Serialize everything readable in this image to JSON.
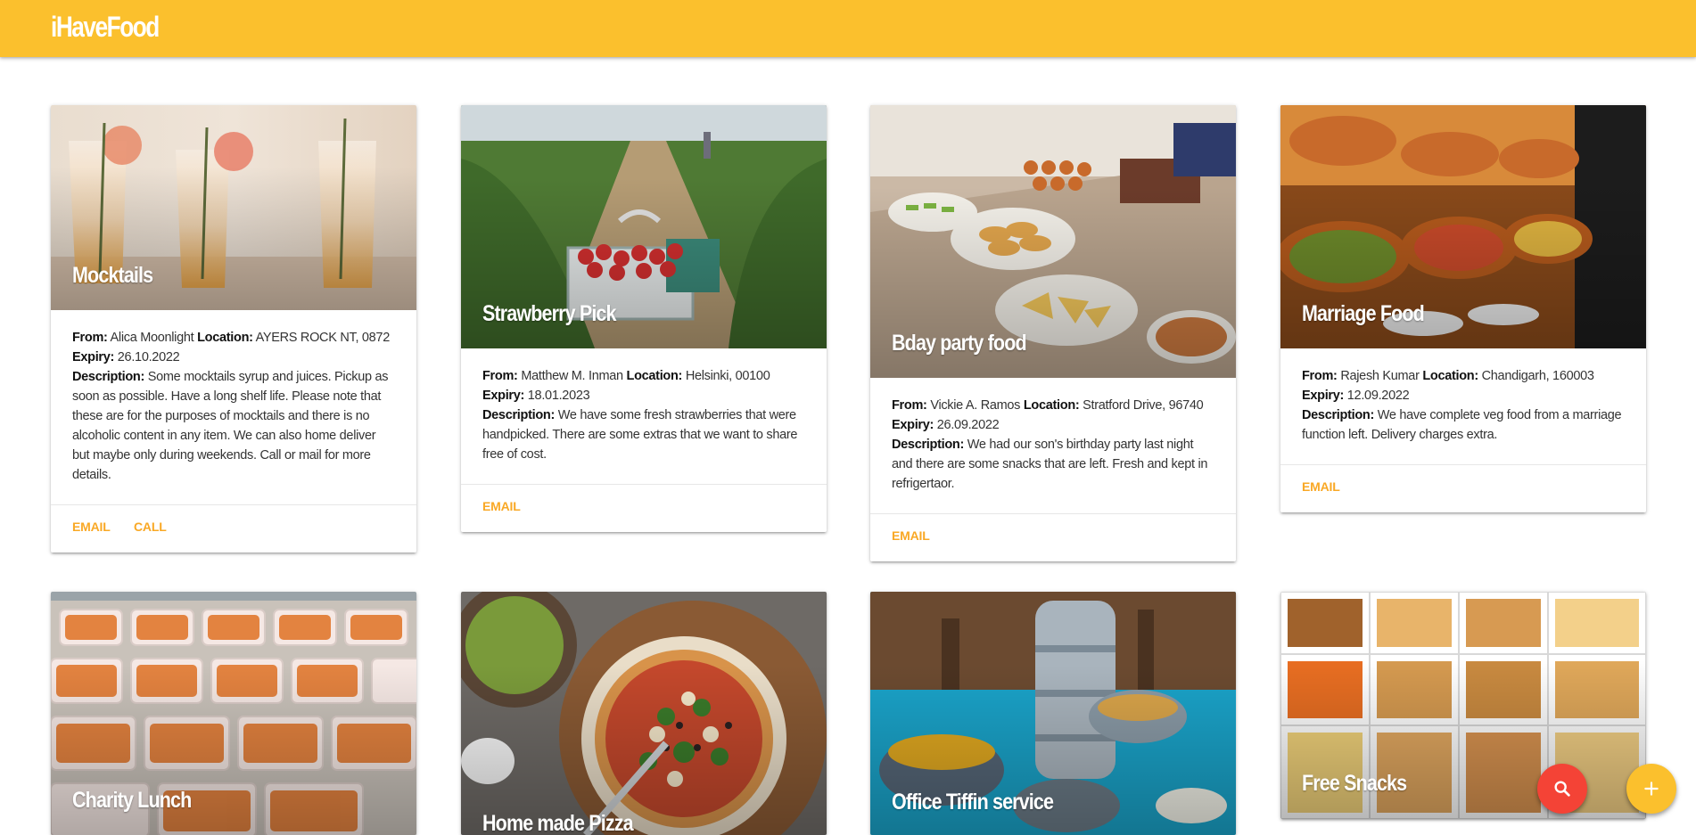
{
  "app": {
    "title": "iHaveFood"
  },
  "colors": {
    "header": "#fbc02d",
    "accent": "#f9a825",
    "search_fab": "#f44336",
    "add_fab": "#fbc02d"
  },
  "cards": [
    {
      "title": "Mocktails",
      "from_label": "From:",
      "from": "Alica Moonlight",
      "location_label": "Location:",
      "location": "AYERS ROCK NT, 0872",
      "expiry_label": "Expiry:",
      "expiry": "26.10.2022",
      "description_label": "Description:",
      "description": "Some mocktails syrup and juices. Pickup as soon as possible. Have a long shelf life. Please note that these are for the purposes of mocktails and there is no alcoholic content in any item. We can also home deliver but maybe only during weekends. Call or mail for more details.",
      "actions": [
        "EMAIL",
        "CALL"
      ]
    },
    {
      "title": "Strawberry Pick",
      "from_label": "From:",
      "from": "Matthew M. Inman",
      "location_label": "Location:",
      "location": "Helsinki, 00100",
      "expiry_label": "Expiry:",
      "expiry": "18.01.2023",
      "description_label": "Description:",
      "description": "We have some fresh strawberries that were handpicked. There are some extras that we want to share free of cost.",
      "actions": [
        "EMAIL"
      ]
    },
    {
      "title": "Bday party food",
      "from_label": "From:",
      "from": "Vickie A. Ramos",
      "location_label": "Location:",
      "location": "Stratford Drive, 96740",
      "expiry_label": "Expiry:",
      "expiry": "26.09.2022",
      "description_label": "Description:",
      "description": "We had our son's birthday party last night and there are some snacks that are left. Fresh and kept in refrigertaor.",
      "actions": [
        "EMAIL"
      ]
    },
    {
      "title": "Marriage Food",
      "from_label": "From:",
      "from": "Rajesh Kumar",
      "location_label": "Location:",
      "location": "Chandigarh, 160003",
      "expiry_label": "Expiry:",
      "expiry": "12.09.2022",
      "description_label": "Description:",
      "description": "We have complete veg food from a marriage function left. Delivery charges extra.",
      "actions": [
        "EMAIL"
      ]
    },
    {
      "title": "Charity Lunch"
    },
    {
      "title": "Home made Pizza"
    },
    {
      "title": "Office Tiffin service"
    },
    {
      "title": "Free Snacks"
    }
  ],
  "fabs": {
    "search_icon": "search-icon",
    "add_icon": "plus-icon"
  }
}
